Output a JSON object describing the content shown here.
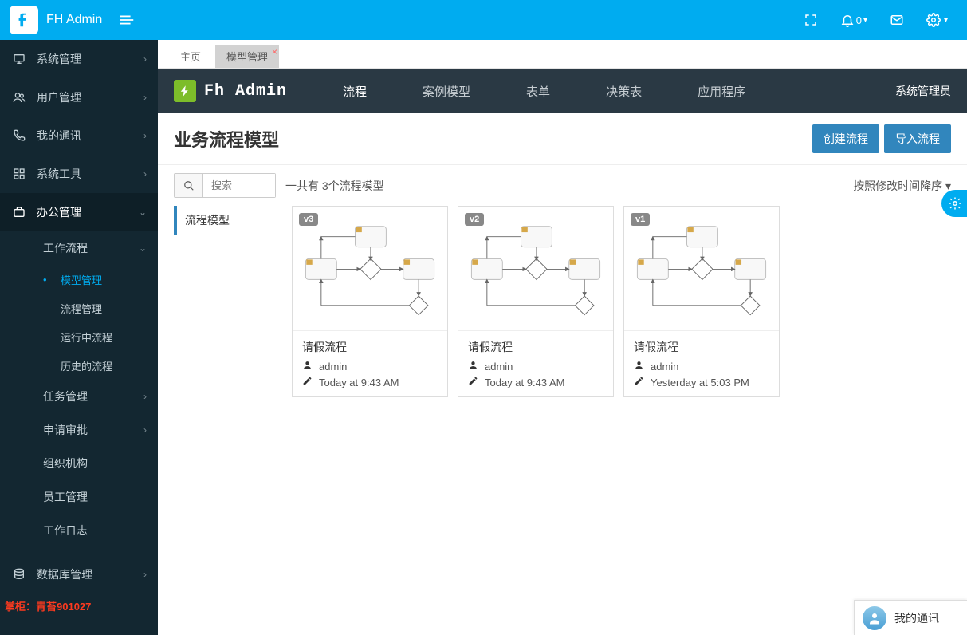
{
  "brand": "FH Admin",
  "topbar": {
    "bell_count": "0"
  },
  "sidebar": {
    "items": [
      {
        "label": "系统管理"
      },
      {
        "label": "用户管理"
      },
      {
        "label": "我的通讯"
      },
      {
        "label": "系统工具"
      },
      {
        "label": "办公管理"
      },
      {
        "label": "数据库管理"
      }
    ],
    "office_sub": {
      "workflow": "工作流程",
      "task": "任务管理",
      "approve": "申请审批",
      "org": "组织机构",
      "employee": "员工管理",
      "worklog": "工作日志"
    },
    "workflow_sub": {
      "model": "模型管理",
      "process": "流程管理",
      "running": "运行中流程",
      "history": "历史的流程"
    },
    "watermark": "掌柜：青苔901027"
  },
  "tabs": {
    "home": "主页",
    "model": "模型管理"
  },
  "wb": {
    "logo_text": "Fh Admin",
    "nav": {
      "process": "流程",
      "case": "案例模型",
      "form": "表单",
      "decision": "决策表",
      "app": "应用程序"
    },
    "user": "系统管理员",
    "title": "业务流程模型",
    "btn_create": "创建流程",
    "btn_import": "导入流程",
    "search_placeholder": "搜索",
    "count_text": "一共有 3个流程模型",
    "sort_text": "按照修改时间降序",
    "filter_process": "流程模型"
  },
  "cards": [
    {
      "version": "v3",
      "title": "请假流程",
      "author": "admin",
      "time": "Today at 9:43 AM"
    },
    {
      "version": "v2",
      "title": "请假流程",
      "author": "admin",
      "time": "Today at 9:43 AM"
    },
    {
      "version": "v1",
      "title": "请假流程",
      "author": "admin",
      "time": "Yesterday at 5:03 PM"
    }
  ],
  "chat": {
    "label": "我的通讯"
  }
}
